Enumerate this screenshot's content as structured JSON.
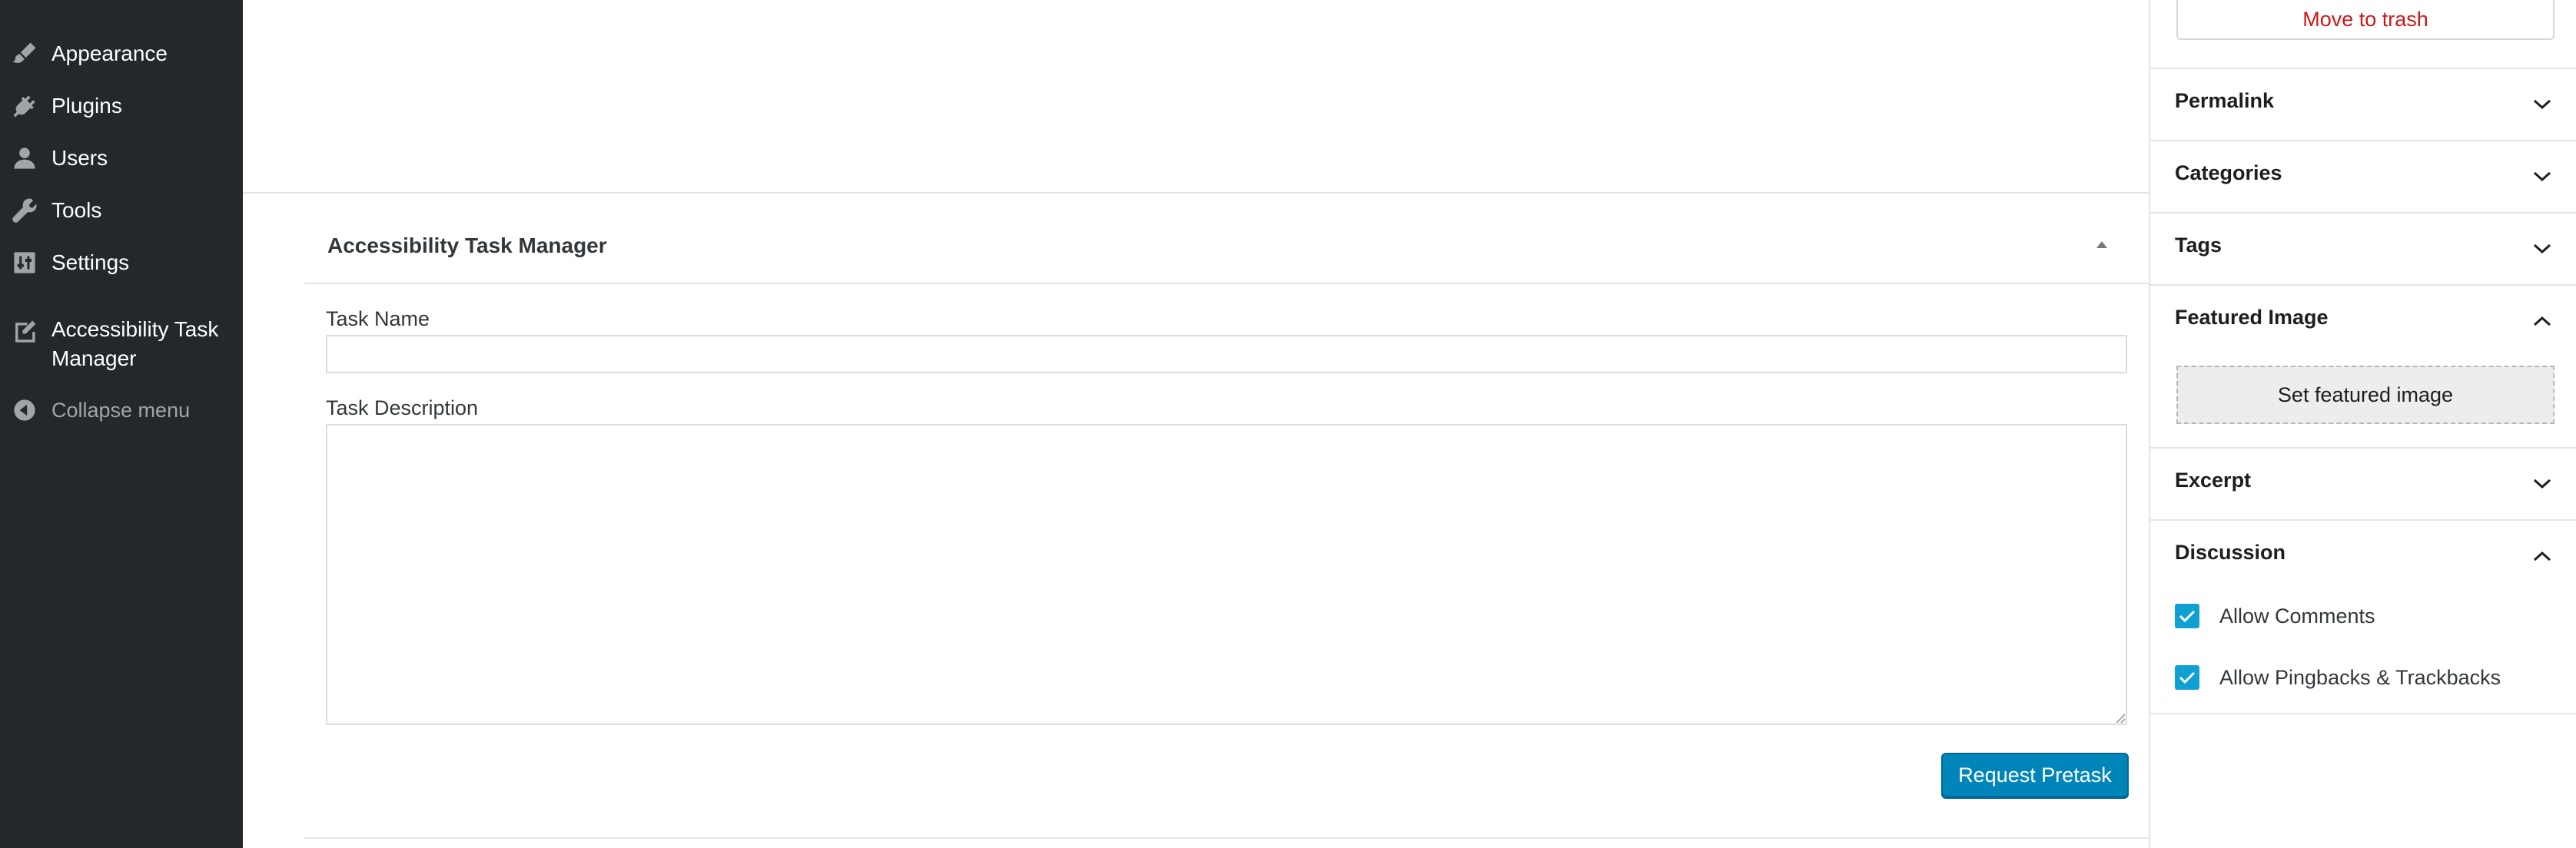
{
  "admin_menu": {
    "items": [
      {
        "label": "Appearance",
        "icon": "paintbrush-icon"
      },
      {
        "label": "Plugins",
        "icon": "plug-icon"
      },
      {
        "label": "Users",
        "icon": "user-icon"
      },
      {
        "label": "Tools",
        "icon": "wrench-icon"
      },
      {
        "label": "Settings",
        "icon": "sliders-icon"
      },
      {
        "label": "Accessibility Task Manager",
        "icon": "edit-page-icon"
      }
    ],
    "collapse_label": "Collapse menu"
  },
  "metabox": {
    "title": "Accessibility Task Manager",
    "task_name_label": "Task Name",
    "task_name_value": "",
    "task_description_label": "Task Description",
    "task_description_value": "",
    "request_button_label": "Request Pretask"
  },
  "settings_sidebar": {
    "trash_label": "Move to trash",
    "panels": {
      "permalink": "Permalink",
      "categories": "Categories",
      "tags": "Tags",
      "featured_image": "Featured Image",
      "excerpt": "Excerpt",
      "discussion": "Discussion"
    },
    "featured_image_button": "Set featured image",
    "discussion_options": [
      {
        "label": "Allow Comments",
        "checked": true
      },
      {
        "label": "Allow Pingbacks & Trackbacks",
        "checked": true
      }
    ]
  },
  "colors": {
    "sidebar_bg": "#23282d",
    "primary_button": "#0085ba",
    "checkbox": "#11a0d2",
    "trash_text": "#cc1818"
  }
}
